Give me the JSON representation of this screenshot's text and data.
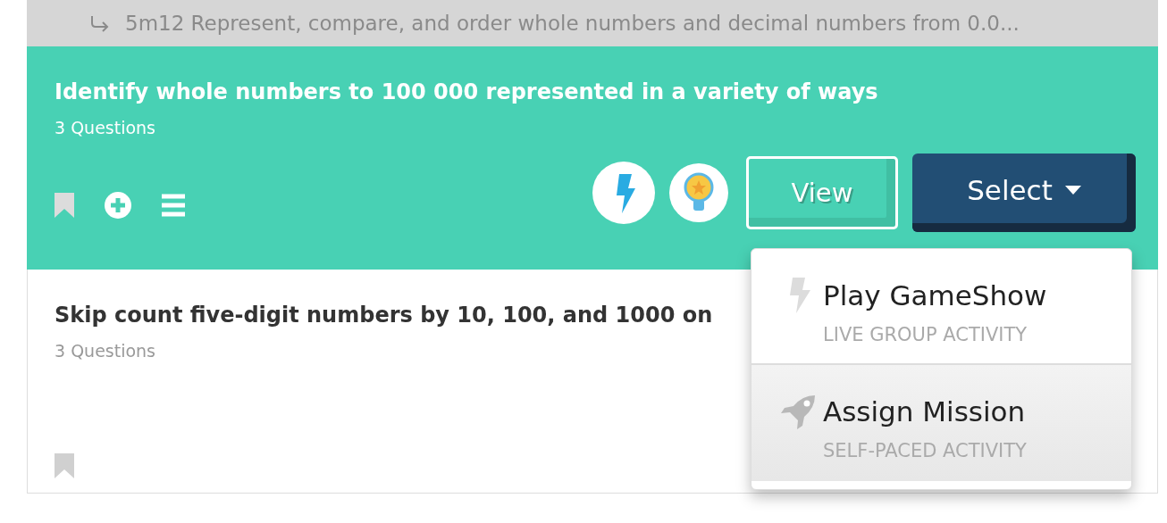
{
  "parent_standard": {
    "text": "5m12 Represent, compare, and order whole numbers and decimal numbers from 0.0..."
  },
  "cards": [
    {
      "title": "Identify whole numbers to 100 000 represented in a variety of ways",
      "questions": "3 Questions",
      "selected": true,
      "view_button": "View",
      "select_button": "Select"
    },
    {
      "title": "Skip count five-digit numbers by 10, 100, and 1000 on",
      "questions": "3 Questions",
      "selected": false
    }
  ],
  "select_menu": {
    "items": [
      {
        "kind": "gameshow",
        "title": "Play GameShow",
        "subtitle": "LIVE GROUP ACTIVITY",
        "selected": false
      },
      {
        "kind": "mission",
        "title": "Assign Mission",
        "subtitle": "SELF-PACED ACTIVITY",
        "selected": true
      }
    ]
  }
}
